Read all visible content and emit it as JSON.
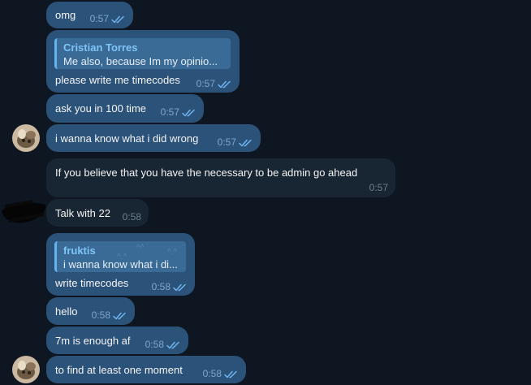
{
  "messages": [
    {
      "text": "omg",
      "time": "0:57"
    },
    {
      "reply_author": "Cristian Torres",
      "reply_snippet": "Me also, because Im my opinio...",
      "text": "please write me timecodes",
      "time": "0:57"
    },
    {
      "text": "ask you in 100 time",
      "time": "0:57"
    },
    {
      "text": "i wanna know what i did wrong",
      "time": "0:57"
    },
    {
      "text": "If you believe that you have the necessary to be admin go ahead",
      "time": "0:57"
    },
    {
      "text": "Talk with 22",
      "time": "0:58"
    },
    {
      "reply_author": "fruktis",
      "reply_snippet": "i wanna know what i di...",
      "text": "write timecodes",
      "time": "0:58"
    },
    {
      "text": "hello",
      "time": "0:58"
    },
    {
      "text": "7m is enough af",
      "time": "0:58"
    },
    {
      "text": "to find at least one moment",
      "time": "0:58"
    }
  ],
  "icons": {
    "read_receipt": "double-check-icon",
    "avatar": "user-avatar"
  },
  "colors": {
    "background": "#0e1621",
    "outgoing_bubble": "#2b5278",
    "incoming_bubble": "#182533",
    "reply_accent": "#64b5ef",
    "reply_author": "#7ec5f7"
  }
}
